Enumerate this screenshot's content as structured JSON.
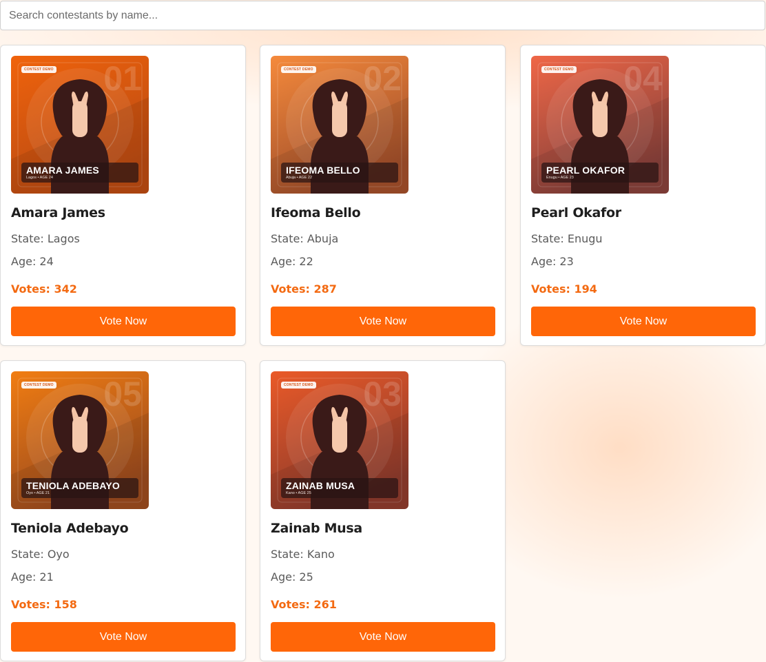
{
  "search": {
    "placeholder": "Search contestants by name..."
  },
  "contestants": [
    {
      "name": "Amara James",
      "state": "State: Lagos",
      "age": "Age: 24",
      "votes": "Votes: 342",
      "button_label": "Vote Now",
      "image_badge": "CONTEST DEMO",
      "image_number": "01",
      "image_name": "AMARA JAMES",
      "image_sub": "Lagos  •  AGE 24",
      "image_colors": [
        "#f0630c",
        "#b94a12"
      ]
    },
    {
      "name": "Ifeoma Bello",
      "state": "State: Abuja",
      "age": "Age: 22",
      "votes": "Votes: 287",
      "button_label": "Vote Now",
      "image_badge": "CONTEST DEMO",
      "image_number": "02",
      "image_name": "IFEOMA BELLO",
      "image_sub": "Abuja  •  AGE 22",
      "image_colors": [
        "#f58a3c",
        "#a04e2a"
      ]
    },
    {
      "name": "Pearl Okafor",
      "state": "State: Enugu",
      "age": "Age: 23",
      "votes": "Votes: 194",
      "button_label": "Vote Now",
      "image_badge": "CONTEST DEMO",
      "image_number": "04",
      "image_name": "PEARL OKAFOR",
      "image_sub": "Enugu  •  AGE 23",
      "image_colors": [
        "#ef6747",
        "#86403a"
      ]
    },
    {
      "name": "Teniola Adebayo",
      "state": "State: Oyo",
      "age": "Age: 21",
      "votes": "Votes: 158",
      "button_label": "Vote Now",
      "image_badge": "CONTEST DEMO",
      "image_number": "05",
      "image_name": "TENIOLA ADEBAYO",
      "image_sub": "Oyo  •  AGE 21",
      "image_colors": [
        "#f17d12",
        "#9a4a1e"
      ]
    },
    {
      "name": "Zainab Musa",
      "state": "State: Kano",
      "age": "Age: 25",
      "votes": "Votes: 261",
      "button_label": "Vote Now",
      "image_badge": "CONTEST DEMO",
      "image_number": "03",
      "image_name": "ZAINAB MUSA",
      "image_sub": "Kano  •  AGE 25",
      "image_colors": [
        "#ea5a28",
        "#8c3a2c"
      ]
    }
  ]
}
